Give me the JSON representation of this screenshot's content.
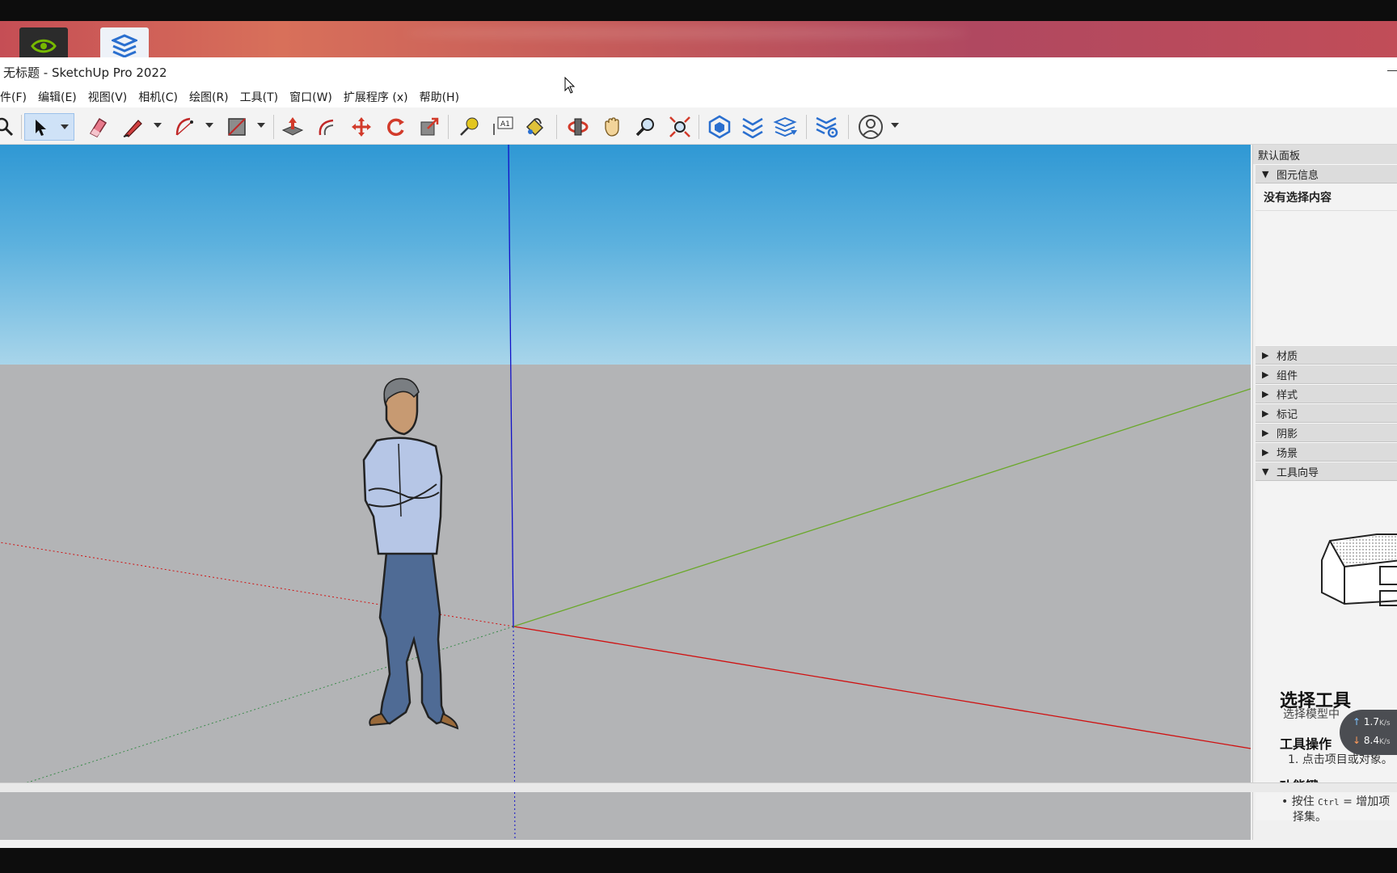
{
  "window": {
    "title": "无标题 - SketchUp Pro 2022"
  },
  "menu": [
    {
      "label": "件(F)"
    },
    {
      "label": "编辑(E)"
    },
    {
      "label": "视图(V)"
    },
    {
      "label": "相机(C)"
    },
    {
      "label": "绘图(R)"
    },
    {
      "label": "工具(T)"
    },
    {
      "label": "窗口(W)"
    },
    {
      "label": "扩展程序 (x)"
    },
    {
      "label": "帮助(H)"
    }
  ],
  "toolbar": {
    "icons": [
      "zoom-icon",
      "select-icon",
      "eraser-icon",
      "pencil-icon",
      "arc-icon",
      "rectangle-icon",
      "push-pull-icon",
      "offset-icon",
      "move-icon",
      "rotate-icon",
      "scale-icon",
      "tape-measure-icon",
      "text-icon",
      "paint-bucket-icon",
      "orbit-icon",
      "pan-icon",
      "zoom-tool-icon",
      "zoom-extents-icon",
      "3d-warehouse-icon",
      "extension-warehouse-icon",
      "layout-icon",
      "extension-manager-icon",
      "account-icon"
    ],
    "text_tool_glyph": "A1"
  },
  "panel": {
    "title": "默认面板",
    "entity_info": {
      "label": "图元信息",
      "empty_text": "没有选择内容"
    },
    "sections": [
      {
        "label": "材质"
      },
      {
        "label": "组件"
      },
      {
        "label": "样式"
      },
      {
        "label": "标记"
      },
      {
        "label": "阴影"
      },
      {
        "label": "场景"
      }
    ],
    "instructor": {
      "label": "工具向导",
      "tool_name": "选择工具",
      "tool_desc": "选择模型中",
      "ops_heading": "工具操作",
      "ops_item": "1. 点击项目或对象。",
      "keys_heading": "功能键",
      "keys_item_prefix": "• 按住",
      "keys_item_key": "Ctrl",
      "keys_item_suffix": "= 增加项",
      "keys_item_wrap": "择集。"
    }
  },
  "network": {
    "upload": "1.7",
    "download": "8.4",
    "unit": "K/s"
  },
  "colors": {
    "sky_top": "#2f98d4",
    "sky_bottom": "#a8d5ea",
    "ground": "#b3b4b6",
    "axis_red": "#d01010",
    "axis_green": "#6aa82a",
    "axis_blue": "#1010c8",
    "active_tool": "#cfe2f7"
  }
}
